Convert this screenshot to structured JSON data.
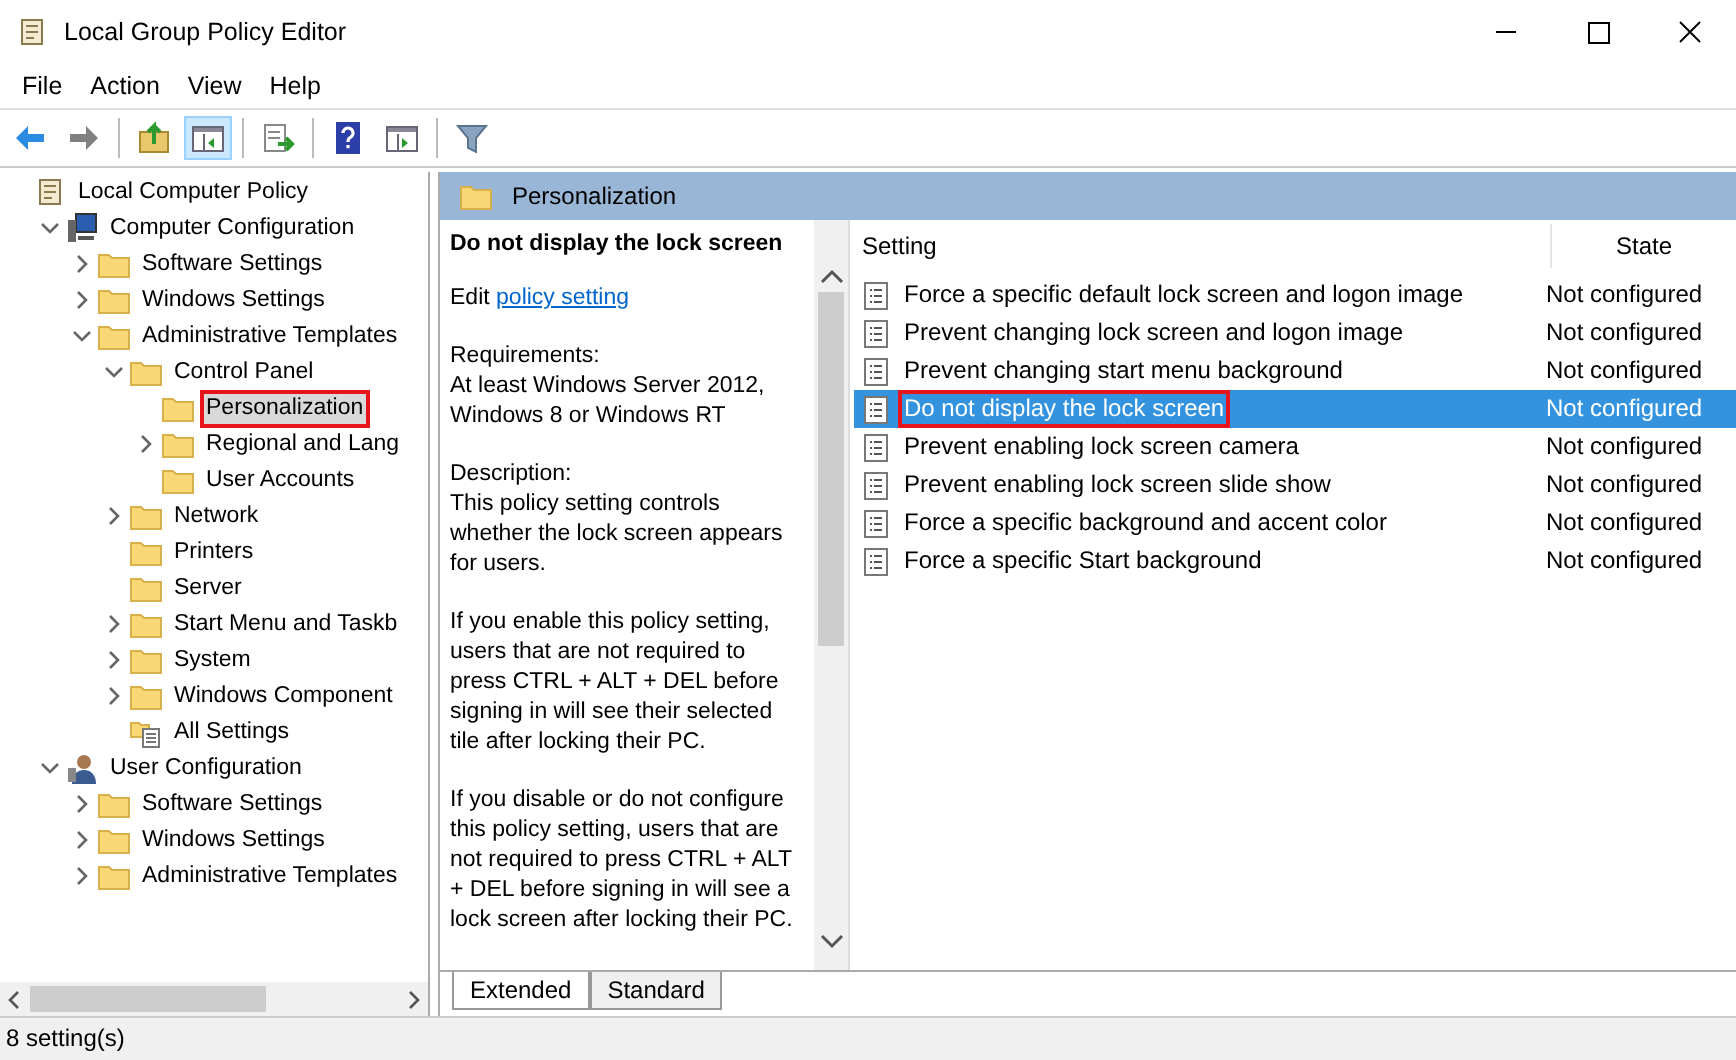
{
  "window": {
    "title": "Local Group Policy Editor"
  },
  "menu": [
    "File",
    "Action",
    "View",
    "Help"
  ],
  "toolbar": [
    [
      {
        "kind": "back",
        "selected": false
      },
      {
        "kind": "forward",
        "selected": false
      }
    ],
    [
      {
        "kind": "up",
        "selected": false
      },
      {
        "kind": "pane",
        "selected": true
      }
    ],
    [
      {
        "kind": "export",
        "selected": false
      }
    ],
    [
      {
        "kind": "help",
        "selected": false
      },
      {
        "kind": "pane2",
        "selected": false
      }
    ],
    [
      {
        "kind": "filter",
        "selected": false
      }
    ]
  ],
  "tree": [
    {
      "label": "Local Computer Policy",
      "kind": "policy",
      "selected": false,
      "marked": false,
      "children": [
        {
          "label": "Computer Configuration",
          "kind": "computer",
          "expanded": true,
          "selected": false,
          "marked": false,
          "children": [
            {
              "label": "Software Settings",
              "kind": "folder",
              "expanded": false,
              "selected": false,
              "marked": false
            },
            {
              "label": "Windows Settings",
              "kind": "folder",
              "expanded": false,
              "selected": false,
              "marked": false
            },
            {
              "label": "Administrative Templates",
              "kind": "folder",
              "expanded": true,
              "selected": false,
              "marked": false,
              "children": [
                {
                  "label": "Control Panel",
                  "kind": "folder",
                  "expanded": true,
                  "selected": false,
                  "marked": false,
                  "children": [
                    {
                      "label": "Personalization",
                      "kind": "folder",
                      "selected": true,
                      "marked": true
                    },
                    {
                      "label": "Regional and Lang",
                      "kind": "folder",
                      "expanded": false,
                      "selected": false,
                      "marked": false
                    },
                    {
                      "label": "User Accounts",
                      "kind": "folder",
                      "selected": false,
                      "marked": false
                    }
                  ]
                },
                {
                  "label": "Network",
                  "kind": "folder",
                  "expanded": false,
                  "selected": false,
                  "marked": false
                },
                {
                  "label": "Printers",
                  "kind": "folder",
                  "selected": false,
                  "marked": false
                },
                {
                  "label": "Server",
                  "kind": "folder",
                  "selected": false,
                  "marked": false
                },
                {
                  "label": "Start Menu and Taskb",
                  "kind": "folder",
                  "expanded": false,
                  "selected": false,
                  "marked": false
                },
                {
                  "label": "System",
                  "kind": "folder",
                  "expanded": false,
                  "selected": false,
                  "marked": false
                },
                {
                  "label": "Windows Component",
                  "kind": "folder",
                  "expanded": false,
                  "selected": false,
                  "marked": false
                },
                {
                  "label": "All Settings",
                  "kind": "settings",
                  "selected": false,
                  "marked": false
                }
              ]
            }
          ]
        },
        {
          "label": "User Configuration",
          "kind": "user",
          "expanded": true,
          "selected": false,
          "marked": false,
          "children": [
            {
              "label": "Software Settings",
              "kind": "folder",
              "expanded": false,
              "selected": false,
              "marked": false
            },
            {
              "label": "Windows Settings",
              "kind": "folder",
              "expanded": false,
              "selected": false,
              "marked": false
            },
            {
              "label": "Administrative Templates",
              "kind": "folder",
              "expanded": false,
              "selected": false,
              "marked": false
            }
          ]
        }
      ]
    }
  ],
  "header": {
    "title": "Personalization"
  },
  "description": {
    "title": "Do not display the lock screen",
    "edit_prefix": "Edit",
    "edit_link": "policy setting",
    "paragraphs": [
      "Requirements:\nAt least Windows Server 2012, Windows 8 or Windows RT",
      "Description:\nThis policy setting controls whether the lock screen appears for users.",
      "If you enable this policy setting, users that are not required to press CTRL + ALT + DEL before signing in will see their selected tile after locking their PC.",
      "If you disable or do not configure this policy setting, users that are not required to press CTRL + ALT + DEL before signing in will see a lock screen after locking their PC."
    ]
  },
  "table": {
    "columns": [
      "Setting",
      "State"
    ],
    "rows": [
      {
        "setting": "Force a specific default lock screen and logon image",
        "state": "Not configured",
        "selected": false,
        "marked": false
      },
      {
        "setting": "Prevent changing lock screen and logon image",
        "state": "Not configured",
        "selected": false,
        "marked": false
      },
      {
        "setting": "Prevent changing start menu background",
        "state": "Not configured",
        "selected": false,
        "marked": false
      },
      {
        "setting": "Do not display the lock screen",
        "state": "Not configured",
        "selected": true,
        "marked": true
      },
      {
        "setting": "Prevent enabling lock screen camera",
        "state": "Not configured",
        "selected": false,
        "marked": false
      },
      {
        "setting": "Prevent enabling lock screen slide show",
        "state": "Not configured",
        "selected": false,
        "marked": false
      },
      {
        "setting": "Force a specific background and accent color",
        "state": "Not configured",
        "selected": false,
        "marked": false
      },
      {
        "setting": "Force a specific Start background",
        "state": "Not configured",
        "selected": false,
        "marked": false
      }
    ]
  },
  "tabs": [
    {
      "label": "Extended",
      "selected": true
    },
    {
      "label": "Standard",
      "selected": false
    }
  ],
  "status_bar": "8 setting(s)"
}
